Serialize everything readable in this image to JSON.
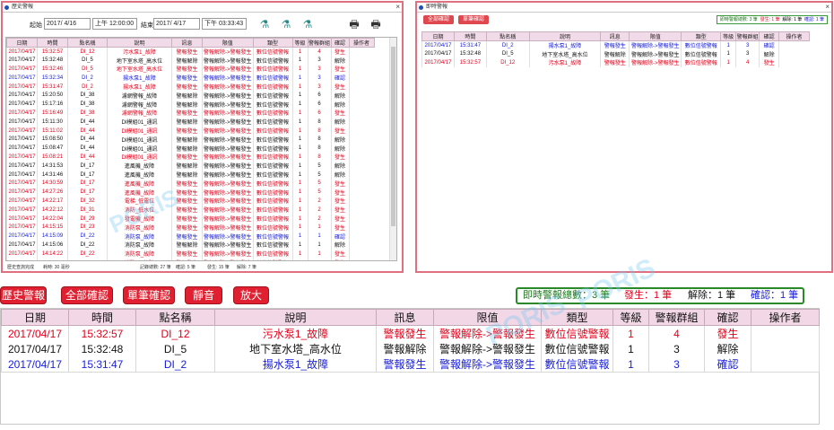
{
  "colors": {
    "red": "#e0001a",
    "blue": "#1a20d8",
    "black": "#111111"
  },
  "history_window": {
    "title": "歷史警報",
    "start_label": "起始",
    "start_date": "2017/ 4/16",
    "start_time": "上午 12:00:00",
    "end_label": "結束",
    "end_date": "2017/ 4/17",
    "end_time": "下午 03:33:43",
    "columns": [
      "日期",
      "時間",
      "點名稱",
      "說明",
      "訊息",
      "限值",
      "類型",
      "等級",
      "警報群組",
      "確認",
      "操作者"
    ],
    "rows": [
      {
        "c": "red",
        "v": [
          "2017/04/17",
          "15:32:57",
          "DI_12",
          "污水泵1_故障",
          "警報發生",
          "警報解除->警報發生",
          "數位信號警報",
          "1",
          "4",
          "發生",
          ""
        ]
      },
      {
        "c": "black",
        "v": [
          "2017/04/17",
          "15:32:48",
          "DI_5",
          "地下室水塔_高水位",
          "警報解除",
          "警報解除->警報發生",
          "數位信號警報",
          "1",
          "3",
          "解除",
          ""
        ]
      },
      {
        "c": "red",
        "v": [
          "2017/04/17",
          "15:32:46",
          "DI_5",
          "地下室水塔_高水位",
          "警報發生",
          "警報解除->警報發生",
          "數位信號警報",
          "1",
          "3",
          "發生",
          ""
        ]
      },
      {
        "c": "blue",
        "v": [
          "2017/04/17",
          "15:32:34",
          "DI_2",
          "揚水泵1_故障",
          "警報發生",
          "警報解除->警報發生",
          "數位信號警報",
          "1",
          "3",
          "確認",
          ""
        ]
      },
      {
        "c": "red",
        "v": [
          "2017/04/17",
          "15:31:47",
          "DI_2",
          "揚水泵1_故障",
          "警報發生",
          "警報解除->警報發生",
          "數位信號警報",
          "1",
          "3",
          "發生",
          ""
        ]
      },
      {
        "c": "black",
        "v": [
          "2017/04/17",
          "15:20:50",
          "DI_38",
          "濾網警報_故障",
          "警報解除",
          "警報解除->警報發生",
          "數位信號警報",
          "1",
          "6",
          "解除",
          ""
        ]
      },
      {
        "c": "black",
        "v": [
          "2017/04/17",
          "15:17:16",
          "DI_38",
          "濾網警報_故障",
          "警報解除",
          "警報解除->警報發生",
          "數位信號警報",
          "1",
          "6",
          "解除",
          ""
        ]
      },
      {
        "c": "red",
        "v": [
          "2017/04/17",
          "15:16:49",
          "DI_38",
          "濾網警報_故障",
          "警報發生",
          "警報解除->警報發生",
          "數位信號警報",
          "1",
          "6",
          "發生",
          ""
        ]
      },
      {
        "c": "black",
        "v": [
          "2017/04/17",
          "15:11:30",
          "DI_44",
          "DI模組01_通訊",
          "警報解除",
          "警報解除->警報發生",
          "數位信號警報",
          "1",
          "8",
          "解除",
          ""
        ]
      },
      {
        "c": "red",
        "v": [
          "2017/04/17",
          "15:11:02",
          "DI_44",
          "DI模組01_通訊",
          "警報發生",
          "警報解除->警報發生",
          "數位信號警報",
          "1",
          "8",
          "發生",
          ""
        ]
      },
      {
        "c": "black",
        "v": [
          "2017/04/17",
          "15:08:50",
          "DI_44",
          "DI模組01_通訊",
          "警報解除",
          "警報解除->警報發生",
          "數位信號警報",
          "1",
          "8",
          "解除",
          ""
        ]
      },
      {
        "c": "black",
        "v": [
          "2017/04/17",
          "15:08:47",
          "DI_44",
          "DI模組01_通訊",
          "警報解除",
          "警報解除->警報發生",
          "數位信號警報",
          "1",
          "8",
          "解除",
          ""
        ]
      },
      {
        "c": "red",
        "v": [
          "2017/04/17",
          "15:08:21",
          "DI_44",
          "DI模組01_通訊",
          "警報發生",
          "警報解除->警報發生",
          "數位信號警報",
          "1",
          "8",
          "發生",
          ""
        ]
      },
      {
        "c": "black",
        "v": [
          "2017/04/17",
          "14:31:53",
          "DI_17",
          "進風機_故障",
          "警報解除",
          "警報解除->警報發生",
          "數位信號警報",
          "1",
          "5",
          "解除",
          ""
        ]
      },
      {
        "c": "black",
        "v": [
          "2017/04/17",
          "14:31:46",
          "DI_17",
          "進風機_故障",
          "警報解除",
          "警報解除->警報發生",
          "數位信號警報",
          "1",
          "5",
          "解除",
          ""
        ]
      },
      {
        "c": "red",
        "v": [
          "2017/04/17",
          "14:30:59",
          "DI_17",
          "進風機_故障",
          "警報發生",
          "警報解除->警報發生",
          "數位信號警報",
          "1",
          "5",
          "發生",
          ""
        ]
      },
      {
        "c": "red",
        "v": [
          "2017/04/17",
          "14:27:26",
          "DI_17",
          "進風機_故障",
          "警報發生",
          "警報解除->警報發生",
          "數位信號警報",
          "1",
          "5",
          "發生",
          ""
        ]
      },
      {
        "c": "red",
        "v": [
          "2017/04/17",
          "14:22:17",
          "DI_32",
          "電梯_低電位",
          "警報發生",
          "警報解除->警報發生",
          "數位信號警報",
          "1",
          "2",
          "發生",
          ""
        ]
      },
      {
        "c": "red",
        "v": [
          "2017/04/17",
          "14:22:12",
          "DI_31",
          "消防_低水位",
          "警報發生",
          "警報解除->警報發生",
          "數位信號警報",
          "1",
          "2",
          "發生",
          ""
        ]
      },
      {
        "c": "red",
        "v": [
          "2017/04/17",
          "14:22:04",
          "DI_29",
          "發電機_故障",
          "警報發生",
          "警報解除->警報發生",
          "數位信號警報",
          "1",
          "2",
          "發生",
          ""
        ]
      },
      {
        "c": "red",
        "v": [
          "2017/04/17",
          "14:15:15",
          "DI_23",
          "消防泵_故障",
          "警報發生",
          "警報解除->警報發生",
          "數位信號警報",
          "1",
          "1",
          "發生",
          ""
        ]
      },
      {
        "c": "blue",
        "v": [
          "2017/04/17",
          "14:15:09",
          "DI_22",
          "消防泵_故障",
          "警報發生",
          "警報解除->警報發生",
          "數位信號警報",
          "1",
          "1",
          "確認",
          ""
        ]
      },
      {
        "c": "black",
        "v": [
          "2017/04/17",
          "14:15:06",
          "DI_22",
          "消防泵_故障",
          "警報解除",
          "警報解除->警報發生",
          "數位信號警報",
          "1",
          "1",
          "解除",
          ""
        ]
      },
      {
        "c": "red",
        "v": [
          "2017/04/17",
          "14:14:22",
          "DI_22",
          "消防泵_故障",
          "警報發生",
          "警報解除->警報發生",
          "數位信號警報",
          "1",
          "1",
          "發生",
          ""
        ]
      },
      {
        "c": "red",
        "v": [
          "2017/04/17",
          "14:08:08",
          "DI_23",
          "消防泵_故障",
          "警報發生",
          "警報解除->警報發生",
          "數位信號警報",
          "1",
          "1",
          "發生",
          ""
        ]
      }
    ],
    "status": [
      "歷史查詢完成",
      "耗時: 30 毫秒",
      "記錄總數: 27 筆",
      "確認: 5 筆",
      "發生: 15 筆",
      "解除: 7 筆"
    ]
  },
  "realtime_window": {
    "title": "即時警報",
    "ack_all_label": "全部確認",
    "ack_single_label": "單筆確認",
    "stats": {
      "total": "即時警報總數: 3 筆",
      "occurred": "發生: 1 筆",
      "cleared": "解除: 1 筆",
      "acked": "確認: 1 筆"
    },
    "columns": [
      "日期",
      "時間",
      "點名稱",
      "說明",
      "訊息",
      "限值",
      "類型",
      "等級",
      "警報群組",
      "確認",
      "操作者"
    ],
    "rows": [
      {
        "c": "blue",
        "v": [
          "2017/04/17",
          "15:31:47",
          "DI_2",
          "揚水泵1_故障",
          "警報發生",
          "警報解除->警報發生",
          "數位信號警報",
          "1",
          "3",
          "確認",
          ""
        ]
      },
      {
        "c": "black",
        "v": [
          "2017/04/17",
          "15:32:48",
          "DI_5",
          "地下室水塔_高水位",
          "警報解除",
          "警報解除->警報發生",
          "數位信號警報",
          "1",
          "3",
          "解除",
          ""
        ]
      },
      {
        "c": "red",
        "v": [
          "2017/04/17",
          "15:32:57",
          "DI_12",
          "污水泵1_故障",
          "警報發生",
          "警報解除->警報發生",
          "數位信號警報",
          "1",
          "4",
          "發生",
          ""
        ]
      }
    ]
  },
  "main_panel": {
    "buttons": {
      "history": "歷史警報",
      "ack_all": "全部確認",
      "ack_single": "單筆確認",
      "mute": "靜音",
      "zoom": "放大"
    },
    "stats": {
      "total": "即時警報總數：3 筆",
      "occurred": "發生：1 筆",
      "cleared": "解除：1 筆",
      "acked": "確認：1 筆"
    },
    "columns": [
      "日期",
      "時間",
      "點名稱",
      "說明",
      "訊息",
      "限值",
      "類型",
      "等級",
      "警報群組",
      "確認",
      "操作者"
    ],
    "rows": [
      {
        "c": "red",
        "v": [
          "2017/04/17",
          "15:32:57",
          "DI_12",
          "污水泵1_故障",
          "警報發生",
          "警報解除->警報發生",
          "數位信號警報",
          "1",
          "4",
          "發生",
          ""
        ]
      },
      {
        "c": "black",
        "v": [
          "2017/04/17",
          "15:32:48",
          "DI_5",
          "地下室水塔_高水位",
          "警報解除",
          "警報解除->警報發生",
          "數位信號警報",
          "1",
          "3",
          "解除",
          ""
        ]
      },
      {
        "c": "blue",
        "v": [
          "2017/04/17",
          "15:31:47",
          "DI_2",
          "揚水泵1_故障",
          "警報發生",
          "警報解除->警報發生",
          "數位信號警報",
          "1",
          "3",
          "確認",
          ""
        ]
      }
    ]
  },
  "watermark": "PORIS"
}
